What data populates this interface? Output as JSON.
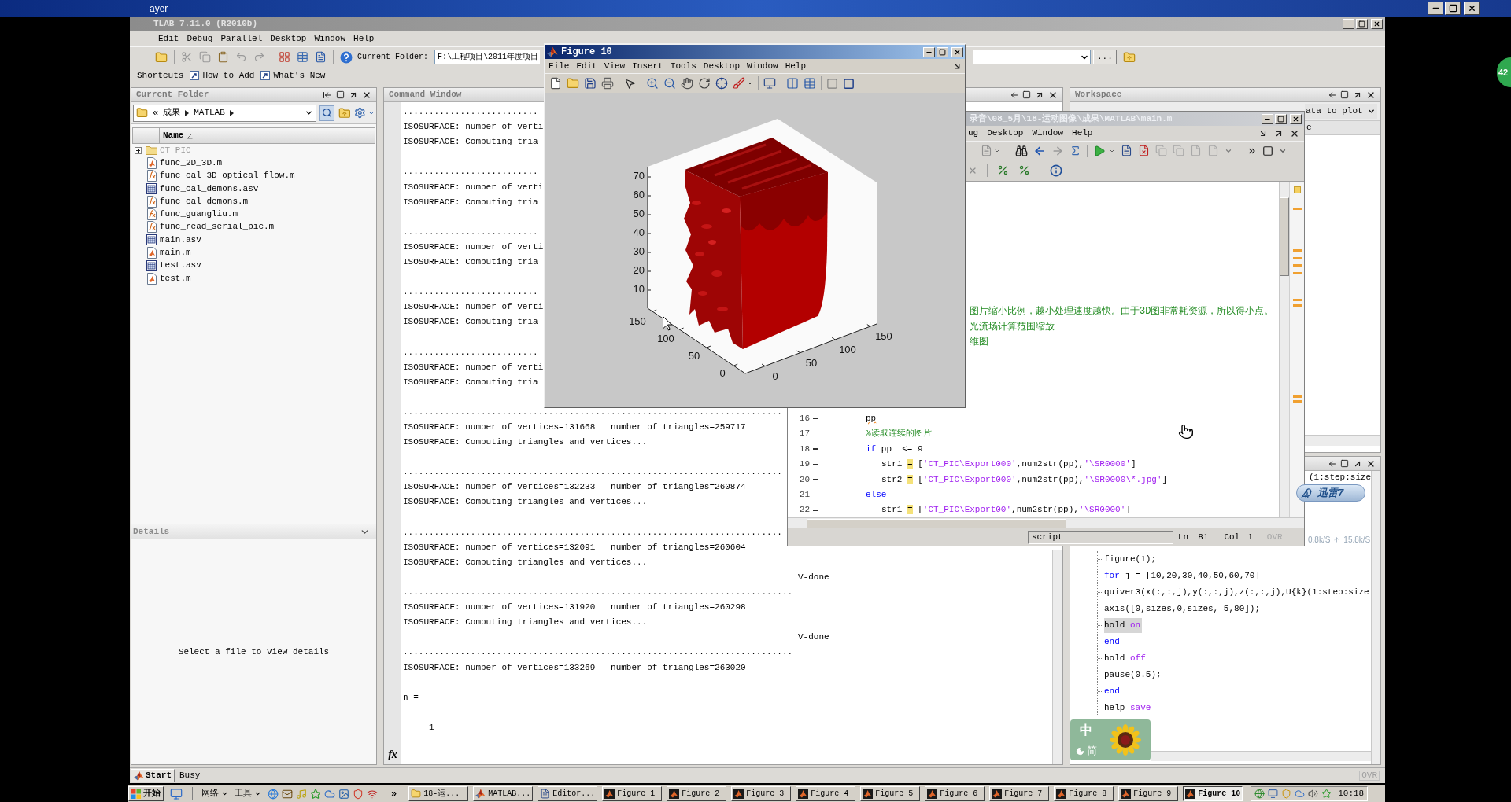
{
  "screen_title_bar": {
    "title": "ayer"
  },
  "speed_ball": {
    "text": "42"
  },
  "matlab": {
    "title": "TLAB 7.11.0 (R2010b)",
    "menu": [
      "Edit",
      "Debug",
      "Parallel",
      "Desktop",
      "Window",
      "Help"
    ],
    "current_folder_label": "Current Folder:",
    "current_folder_path": "F:\\工程项目\\2011年度项目",
    "browse": "...",
    "shortcuts": [
      {
        "label": "Shortcuts",
        "kind": "menu"
      },
      {
        "label": "How to Add",
        "kind": "shortcut"
      },
      {
        "label": "What's New",
        "kind": "shortcut"
      }
    ],
    "status": {
      "start": "Start",
      "message": "Busy",
      "mode": "OVR"
    }
  },
  "current_folder": {
    "title": "Current Folder",
    "path": {
      "overflow": "«",
      "parts": [
        "成果",
        "MATLAB"
      ]
    },
    "column": "Name",
    "files": [
      {
        "name": "CT_PIC",
        "kind": "folder",
        "expanded": false
      },
      {
        "name": "func_2D_3D.m",
        "kind": "script"
      },
      {
        "name": "func_cal_3D_optical_flow.m",
        "kind": "function"
      },
      {
        "name": "func_cal_demons.asv",
        "kind": "autosave"
      },
      {
        "name": "func_cal_demons.m",
        "kind": "function"
      },
      {
        "name": "func_guangliu.m",
        "kind": "function"
      },
      {
        "name": "func_read_serial_pic.m",
        "kind": "function"
      },
      {
        "name": "main.asv",
        "kind": "autosave"
      },
      {
        "name": "main.m",
        "kind": "script"
      },
      {
        "name": "test.asv",
        "kind": "autosave"
      },
      {
        "name": "test.m",
        "kind": "script"
      }
    ]
  },
  "details": {
    "title": "Details",
    "message": "Select a file to view details"
  },
  "command_window": {
    "title": "Command Window",
    "function_browser": "fx",
    "lines": [
      {
        "kind": "dots",
        "text": ".........................."
      },
      {
        "kind": "text",
        "text": "ISOSURFACE: number of verti"
      },
      {
        "kind": "text",
        "text": "ISOSURFACE: Computing tria"
      },
      {
        "kind": "blank"
      },
      {
        "kind": "dots",
        "text": ".........................."
      },
      {
        "kind": "text",
        "text": "ISOSURFACE: number of verti"
      },
      {
        "kind": "text",
        "text": "ISOSURFACE: Computing tria"
      },
      {
        "kind": "blank"
      },
      {
        "kind": "dots",
        "text": ".........................."
      },
      {
        "kind": "text",
        "text": "ISOSURFACE: number of verti"
      },
      {
        "kind": "text",
        "text": "ISOSURFACE: Computing tria"
      },
      {
        "kind": "blank"
      },
      {
        "kind": "dots",
        "text": ".........................."
      },
      {
        "kind": "text",
        "text": "ISOSURFACE: number of verti"
      },
      {
        "kind": "text",
        "text": "ISOSURFACE: Computing tria"
      },
      {
        "kind": "blank"
      },
      {
        "kind": "dots",
        "text": ".........................."
      },
      {
        "kind": "text",
        "text": "ISOSURFACE: number of verti"
      },
      {
        "kind": "text",
        "text": "ISOSURFACE: Computing tria"
      },
      {
        "kind": "blank"
      },
      {
        "kind": "dots",
        "text": "........................................................................."
      },
      {
        "kind": "text",
        "text": "ISOSURFACE: number of vertices=131668   number of triangles=259717"
      },
      {
        "kind": "text",
        "text": "ISOSURFACE: Computing triangles and vertices..."
      },
      {
        "kind": "blank"
      },
      {
        "kind": "dots",
        "text": "........................................................................."
      },
      {
        "kind": "text",
        "text": "ISOSURFACE: number of vertices=132233   number of triangles=260874"
      },
      {
        "kind": "text",
        "text": "ISOSURFACE: Computing triangles and vertices..."
      },
      {
        "kind": "blank"
      },
      {
        "kind": "dots",
        "text": "........................................................................."
      },
      {
        "kind": "text",
        "text": "ISOSURFACE: number of vertices=132091   number of triangles=260604"
      },
      {
        "kind": "text",
        "text": "ISOSURFACE: Computing triangles and vertices..."
      },
      {
        "kind": "offset",
        "text": "V-done"
      },
      {
        "kind": "dots",
        "text": "..........................................................................."
      },
      {
        "kind": "text",
        "text": "ISOSURFACE: number of vertices=131920   number of triangles=260298"
      },
      {
        "kind": "text",
        "text": "ISOSURFACE: Computing triangles and vertices..."
      },
      {
        "kind": "offset",
        "text": "V-done"
      },
      {
        "kind": "dots",
        "text": "..........................................................................."
      },
      {
        "kind": "text",
        "text": "ISOSURFACE: number of vertices=133269   number of triangles=263020"
      },
      {
        "kind": "blank"
      },
      {
        "kind": "text",
        "text": "n ="
      },
      {
        "kind": "blank"
      },
      {
        "kind": "value",
        "text": "1"
      }
    ]
  },
  "workspace": {
    "title": "Workspace",
    "plot_selector": "ata to plot",
    "column": "e"
  },
  "command_history": {
    "partial": "(1:step:size",
    "lines": [
      {
        "selected": false,
        "segments": [
          {
            "kind": "plain",
            "text": "figure(1);"
          }
        ]
      },
      {
        "selected": false,
        "segments": [
          {
            "kind": "keyword",
            "text": "for"
          },
          {
            "kind": "plain",
            "text": " j = [10,20,30,40,50,60,70]"
          }
        ]
      },
      {
        "selected": false,
        "segments": [
          {
            "kind": "plain",
            "text": "quiver3(x(:,:,j),y(:,:,j),z(:,:,j),U{k}(1:step:size"
          }
        ]
      },
      {
        "selected": false,
        "segments": [
          {
            "kind": "plain",
            "text": "axis([0,sizes,0,sizes,-5,80]);"
          }
        ]
      },
      {
        "selected": true,
        "segments": [
          {
            "kind": "plain",
            "text": "hold "
          },
          {
            "kind": "string",
            "text": "on"
          }
        ]
      },
      {
        "selected": false,
        "segments": [
          {
            "kind": "keyword",
            "text": "end"
          }
        ]
      },
      {
        "selected": false,
        "segments": [
          {
            "kind": "plain",
            "text": "hold "
          },
          {
            "kind": "string",
            "text": "off"
          }
        ]
      },
      {
        "selected": false,
        "segments": [
          {
            "kind": "plain",
            "text": "pause(0.5);"
          }
        ]
      },
      {
        "selected": false,
        "segments": [
          {
            "kind": "keyword",
            "text": "end"
          }
        ]
      },
      {
        "selected": false,
        "segments": [
          {
            "kind": "plain",
            "text": "help "
          },
          {
            "kind": "string",
            "text": "save"
          }
        ]
      }
    ]
  },
  "editor": {
    "title": "录音\\08_5月\\18-运动图像\\成果\\MATLAB\\main.m",
    "menu": [
      "ug",
      "Desktop",
      "Window",
      "Help"
    ],
    "partial_lines": [
      {
        "kind": "comment",
        "text": "图片缩小比例，越小处理速度越快。由于3D图非常耗资源，所以得小点。"
      },
      {
        "kind": "comment",
        "text": "光流场计算范围缩放"
      },
      {
        "kind": "comment",
        "text": "维图"
      }
    ],
    "lines": [
      {
        "number": "16",
        "executable": true,
        "segments": [
          {
            "kind": "warning",
            "text": "pp"
          }
        ]
      },
      {
        "number": "17",
        "executable": false,
        "segments": [
          {
            "kind": "comment",
            "text": "%读取连续的图片"
          }
        ]
      },
      {
        "number": "18",
        "executable": true,
        "segments": [
          {
            "kind": "keyword",
            "text": "if"
          },
          {
            "kind": "plain",
            "text": " pp  <= 9"
          }
        ],
        "children": [
          {
            "number": "19",
            "executable": true,
            "segments": [
              {
                "kind": "plain",
                "text": "str1 "
              },
              {
                "kind": "highlight",
                "text": "="
              },
              {
                "kind": "plain",
                "text": " ["
              },
              {
                "kind": "string",
                "text": "'CT_PIC\\Export000'"
              },
              {
                "kind": "plain",
                "text": ",num2str(pp),"
              },
              {
                "kind": "string",
                "text": "'\\SR0000'"
              },
              {
                "kind": "plain",
                "text": "]"
              }
            ]
          },
          {
            "number": "20",
            "executable": true,
            "segments": [
              {
                "kind": "plain",
                "text": "str2 "
              },
              {
                "kind": "highlight",
                "text": "="
              },
              {
                "kind": "plain",
                "text": " ["
              },
              {
                "kind": "string",
                "text": "'CT_PIC\\Export000'"
              },
              {
                "kind": "plain",
                "text": ",num2str(pp),"
              },
              {
                "kind": "string",
                "text": "'\\SR0000\\*.jpg'"
              },
              {
                "kind": "plain",
                "text": "]"
              }
            ]
          }
        ]
      },
      {
        "number": "21",
        "executable": true,
        "segments": [
          {
            "kind": "keyword",
            "text": "else"
          }
        ],
        "children": [
          {
            "number": "22",
            "executable": true,
            "segments": [
              {
                "kind": "plain",
                "text": "str1 "
              },
              {
                "kind": "highlight",
                "text": "="
              },
              {
                "kind": "plain",
                "text": " ["
              },
              {
                "kind": "string",
                "text": "'CT_PIC\\Export00'"
              },
              {
                "kind": "plain",
                "text": ",num2str(pp),"
              },
              {
                "kind": "string",
                "text": "'\\SR0000'"
              },
              {
                "kind": "plain",
                "text": "]"
              }
            ]
          }
        ]
      }
    ],
    "status": {
      "mode": "script",
      "line_label": "Ln",
      "line": "81",
      "column_label": "Col",
      "column": "1",
      "overwrite": "OVR"
    }
  },
  "figure": {
    "title": "Figure 10",
    "menu": [
      "File",
      "Edit",
      "View",
      "Insert",
      "Tools",
      "Desktop",
      "Window",
      "Help"
    ],
    "axes": {
      "z_ticks": [
        "70",
        "60",
        "50",
        "40",
        "30",
        "20",
        "10"
      ],
      "y_ticks": [
        "150",
        "100",
        "50",
        "0"
      ],
      "x_ticks": [
        "0",
        "50",
        "100",
        "150"
      ]
    }
  },
  "floating": {
    "download_badge": "迅雷7",
    "net_speed": {
      "down": "0.8k/S",
      "up": "15.8k/S"
    },
    "ime": {
      "mode": "中",
      "charset": "简"
    }
  },
  "taskbar": {
    "start": "开始",
    "toolbars": [
      "网络",
      "工具"
    ],
    "more": "»",
    "tasks": [
      {
        "label": "18-运...",
        "kind": "folder",
        "selected": false
      },
      {
        "label": "MATLAB...",
        "kind": "matlab",
        "selected": false
      },
      {
        "label": "Editor...",
        "kind": "editor",
        "selected": false
      },
      {
        "label": "Figure 1",
        "kind": "figure",
        "selected": false
      },
      {
        "label": "Figure 2",
        "kind": "figure",
        "selected": false
      },
      {
        "label": "Figure 3",
        "kind": "figure",
        "selected": false
      },
      {
        "label": "Figure 4",
        "kind": "figure",
        "selected": false
      },
      {
        "label": "Figure 5",
        "kind": "figure",
        "selected": false
      },
      {
        "label": "Figure 6",
        "kind": "figure",
        "selected": false
      },
      {
        "label": "Figure 7",
        "kind": "figure",
        "selected": false
      },
      {
        "label": "Figure 8",
        "kind": "figure",
        "selected": false
      },
      {
        "label": "Figure 9",
        "kind": "figure",
        "selected": false
      },
      {
        "label": "Figure 10",
        "kind": "figure",
        "selected": true
      }
    ],
    "clock": "10:18"
  }
}
